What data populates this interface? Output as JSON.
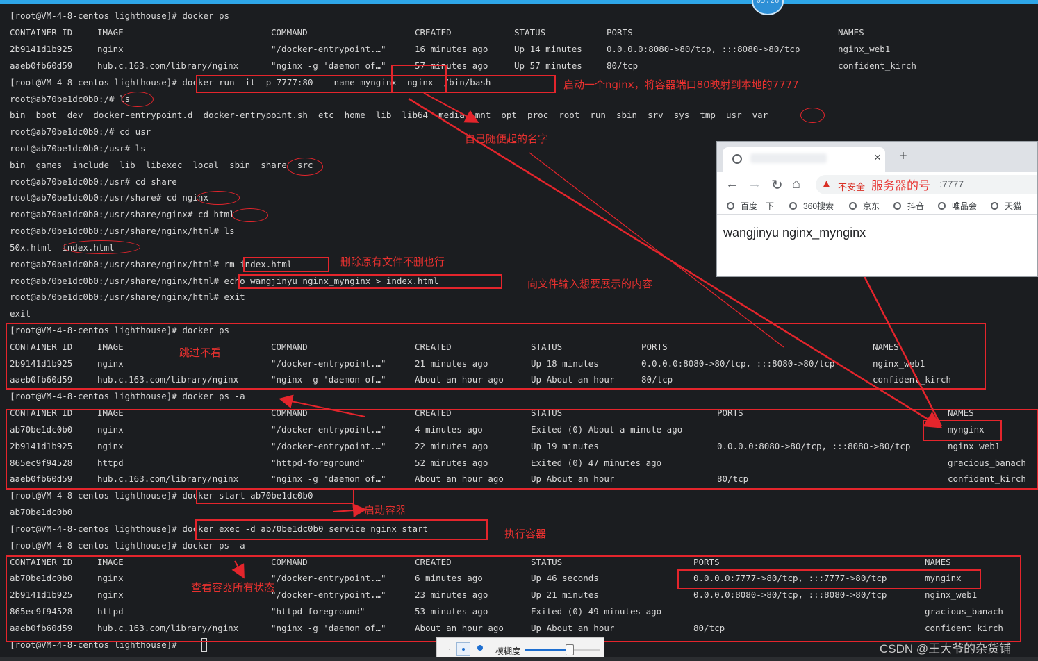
{
  "topbar": {
    "clock": "05:26"
  },
  "terminal": {
    "l01": "[root@VM-4-8-centos lighthouse]# docker ps",
    "h1": {
      "c1": "CONTAINER ID",
      "c2": "IMAGE",
      "c3": "COMMAND",
      "c4": "CREATED",
      "c5": "STATUS",
      "c6": "PORTS",
      "c7": "NAMES"
    },
    "r1a": {
      "c1": "2b9141d1b925",
      "c2": "nginx",
      "c3": "\"/docker-entrypoint.…\"",
      "c4": "16 minutes ago",
      "c5": "Up 14 minutes",
      "c6": "0.0.0.0:8080->80/tcp, :::8080->80/tcp",
      "c7": "nginx_web1"
    },
    "r1b": {
      "c1": "aaeb0fb60d59",
      "c2": "hub.c.163.com/library/nginx",
      "c3": "\"nginx -g 'daemon of…\"",
      "c4": "57 minutes ago",
      "c5": "Up 57 minutes",
      "c6": "80/tcp",
      "c7": "confident_kirch"
    },
    "l05": "[root@VM-4-8-centos lighthouse]# docker run -it -p 7777:80  --name mynginx  nginx  /bin/bash",
    "l06": "root@ab70be1dc0b0:/# ls",
    "l07": "bin  boot  dev  docker-entrypoint.d  docker-entrypoint.sh  etc  home  lib  lib64  media  mnt  opt  proc  root  run  sbin  srv  sys  tmp  usr  var",
    "l08": "root@ab70be1dc0b0:/# cd usr",
    "l09": "root@ab70be1dc0b0:/usr# ls",
    "l10": "bin  games  include  lib  libexec  local  sbin  share  src",
    "l11": "root@ab70be1dc0b0:/usr# cd share",
    "l12": "root@ab70be1dc0b0:/usr/share# cd nginx",
    "l13": "root@ab70be1dc0b0:/usr/share/nginx# cd html",
    "l14": "root@ab70be1dc0b0:/usr/share/nginx/html# ls",
    "l15": "50x.html  index.html",
    "l16": "root@ab70be1dc0b0:/usr/share/nginx/html# rm index.html",
    "l17": "root@ab70be1dc0b0:/usr/share/nginx/html# echo wangjinyu nginx_mynginx > index.html",
    "l18": "root@ab70be1dc0b0:/usr/share/nginx/html# exit",
    "l19": "exit",
    "l20": "[root@VM-4-8-centos lighthouse]# docker ps",
    "h2": {
      "c1": "CONTAINER ID",
      "c2": "IMAGE",
      "c3": "COMMAND",
      "c4": "CREATED",
      "c5": "STATUS",
      "c6": "PORTS",
      "c7": "NAMES"
    },
    "r2a": {
      "c1": "2b9141d1b925",
      "c2": "nginx",
      "c3": "\"/docker-entrypoint.…\"",
      "c4": "21 minutes ago",
      "c5": "Up 18 minutes",
      "c6": "0.0.0.0:8080->80/tcp, :::8080->80/tcp",
      "c7": "nginx_web1"
    },
    "r2b": {
      "c1": "aaeb0fb60d59",
      "c2": "hub.c.163.com/library/nginx",
      "c3": "\"nginx -g 'daemon of…\"",
      "c4": "About an hour ago",
      "c5": "Up About an hour",
      "c6": "80/tcp",
      "c7": "confident_kirch"
    },
    "l24": "[root@VM-4-8-centos lighthouse]# docker ps -a",
    "h3": {
      "c1": "CONTAINER ID",
      "c2": "IMAGE",
      "c3": "COMMAND",
      "c4": "CREATED",
      "c5": "STATUS",
      "c6": "PORTS",
      "c7": "NAMES"
    },
    "r3a": {
      "c1": "ab70be1dc0b0",
      "c2": "nginx",
      "c3": "\"/docker-entrypoint.…\"",
      "c4": "4 minutes ago",
      "c5": "Exited (0) About a minute ago",
      "c6": "",
      "c7": "mynginx"
    },
    "r3b": {
      "c1": "2b9141d1b925",
      "c2": "nginx",
      "c3": "\"/docker-entrypoint.…\"",
      "c4": "22 minutes ago",
      "c5": "Up 19 minutes",
      "c6": "0.0.0.0:8080->80/tcp, :::8080->80/tcp",
      "c7": "nginx_web1"
    },
    "r3c": {
      "c1": "865ec9f94528",
      "c2": "httpd",
      "c3": "\"httpd-foreground\"",
      "c4": "52 minutes ago",
      "c5": "Exited (0) 47 minutes ago",
      "c6": "",
      "c7": "gracious_banach"
    },
    "r3d": {
      "c1": "aaeb0fb60d59",
      "c2": "hub.c.163.com/library/nginx",
      "c3": "\"nginx -g 'daemon of…\"",
      "c4": "About an hour ago",
      "c5": "Up About an hour",
      "c6": "80/tcp",
      "c7": "confident_kirch"
    },
    "l30": "[root@VM-4-8-centos lighthouse]# docker start ab70be1dc0b0",
    "l31": "ab70be1dc0b0",
    "l32": "[root@VM-4-8-centos lighthouse]# docker exec -d ab70be1dc0b0 service nginx start",
    "l33": "[root@VM-4-8-centos lighthouse]# docker ps -a",
    "h4": {
      "c1": "CONTAINER ID",
      "c2": "IMAGE",
      "c3": "COMMAND",
      "c4": "CREATED",
      "c5": "STATUS",
      "c6": "PORTS",
      "c7": "NAMES"
    },
    "r4a": {
      "c1": "ab70be1dc0b0",
      "c2": "nginx",
      "c3": "\"/docker-entrypoint.…\"",
      "c4": "6 minutes ago",
      "c5": "Up 46 seconds",
      "c6": "0.0.0.0:7777->80/tcp, :::7777->80/tcp",
      "c7": "mynginx"
    },
    "r4b": {
      "c1": "2b9141d1b925",
      "c2": "nginx",
      "c3": "\"/docker-entrypoint.…\"",
      "c4": "23 minutes ago",
      "c5": "Up 21 minutes",
      "c6": "0.0.0.0:8080->80/tcp, :::8080->80/tcp",
      "c7": "nginx_web1"
    },
    "r4c": {
      "c1": "865ec9f94528",
      "c2": "httpd",
      "c3": "\"httpd-foreground\"",
      "c4": "53 minutes ago",
      "c5": "Exited (0) 49 minutes ago",
      "c6": "",
      "c7": "gracious_banach"
    },
    "r4d": {
      "c1": "aaeb0fb60d59",
      "c2": "hub.c.163.com/library/nginx",
      "c3": "\"nginx -g 'daemon of…\"",
      "c4": "About an hour ago",
      "c5": "Up About an hour",
      "c6": "80/tcp",
      "c7": "confident_kirch"
    },
    "l39": "[root@VM-4-8-centos lighthouse]# "
  },
  "annotations": {
    "a1": "启动一个nginx，将容器端口80映射到本地的7777",
    "a2": "自己随便起的名字",
    "a3": "删除原有文件不删也行",
    "a4": "向文件输入想要展示的内容",
    "a5": "跳过不看",
    "a6": "启动容器",
    "a7": "执行容器",
    "a8": "查看容器所有状态"
  },
  "browser": {
    "tab_close": "×",
    "new_tab": "+",
    "insecure": "不安全",
    "url_annotation": "服务器的号",
    "url_tail": ":7777",
    "bookmarks": [
      "百度一下",
      "360搜索",
      "京东",
      "抖音",
      "唯品会",
      "天猫"
    ],
    "content": "wangjinyu nginx_mynginx"
  },
  "toolbar": {
    "blur_label": "模糊度",
    "blur_level": 0.6
  },
  "watermark": "CSDN @王大爷的杂货铺",
  "colors": {
    "annotation": "#e4252c",
    "terminal_bg": "#1b1d20",
    "terminal_text": "#d8d8d8",
    "accent": "#2ea6e8"
  }
}
